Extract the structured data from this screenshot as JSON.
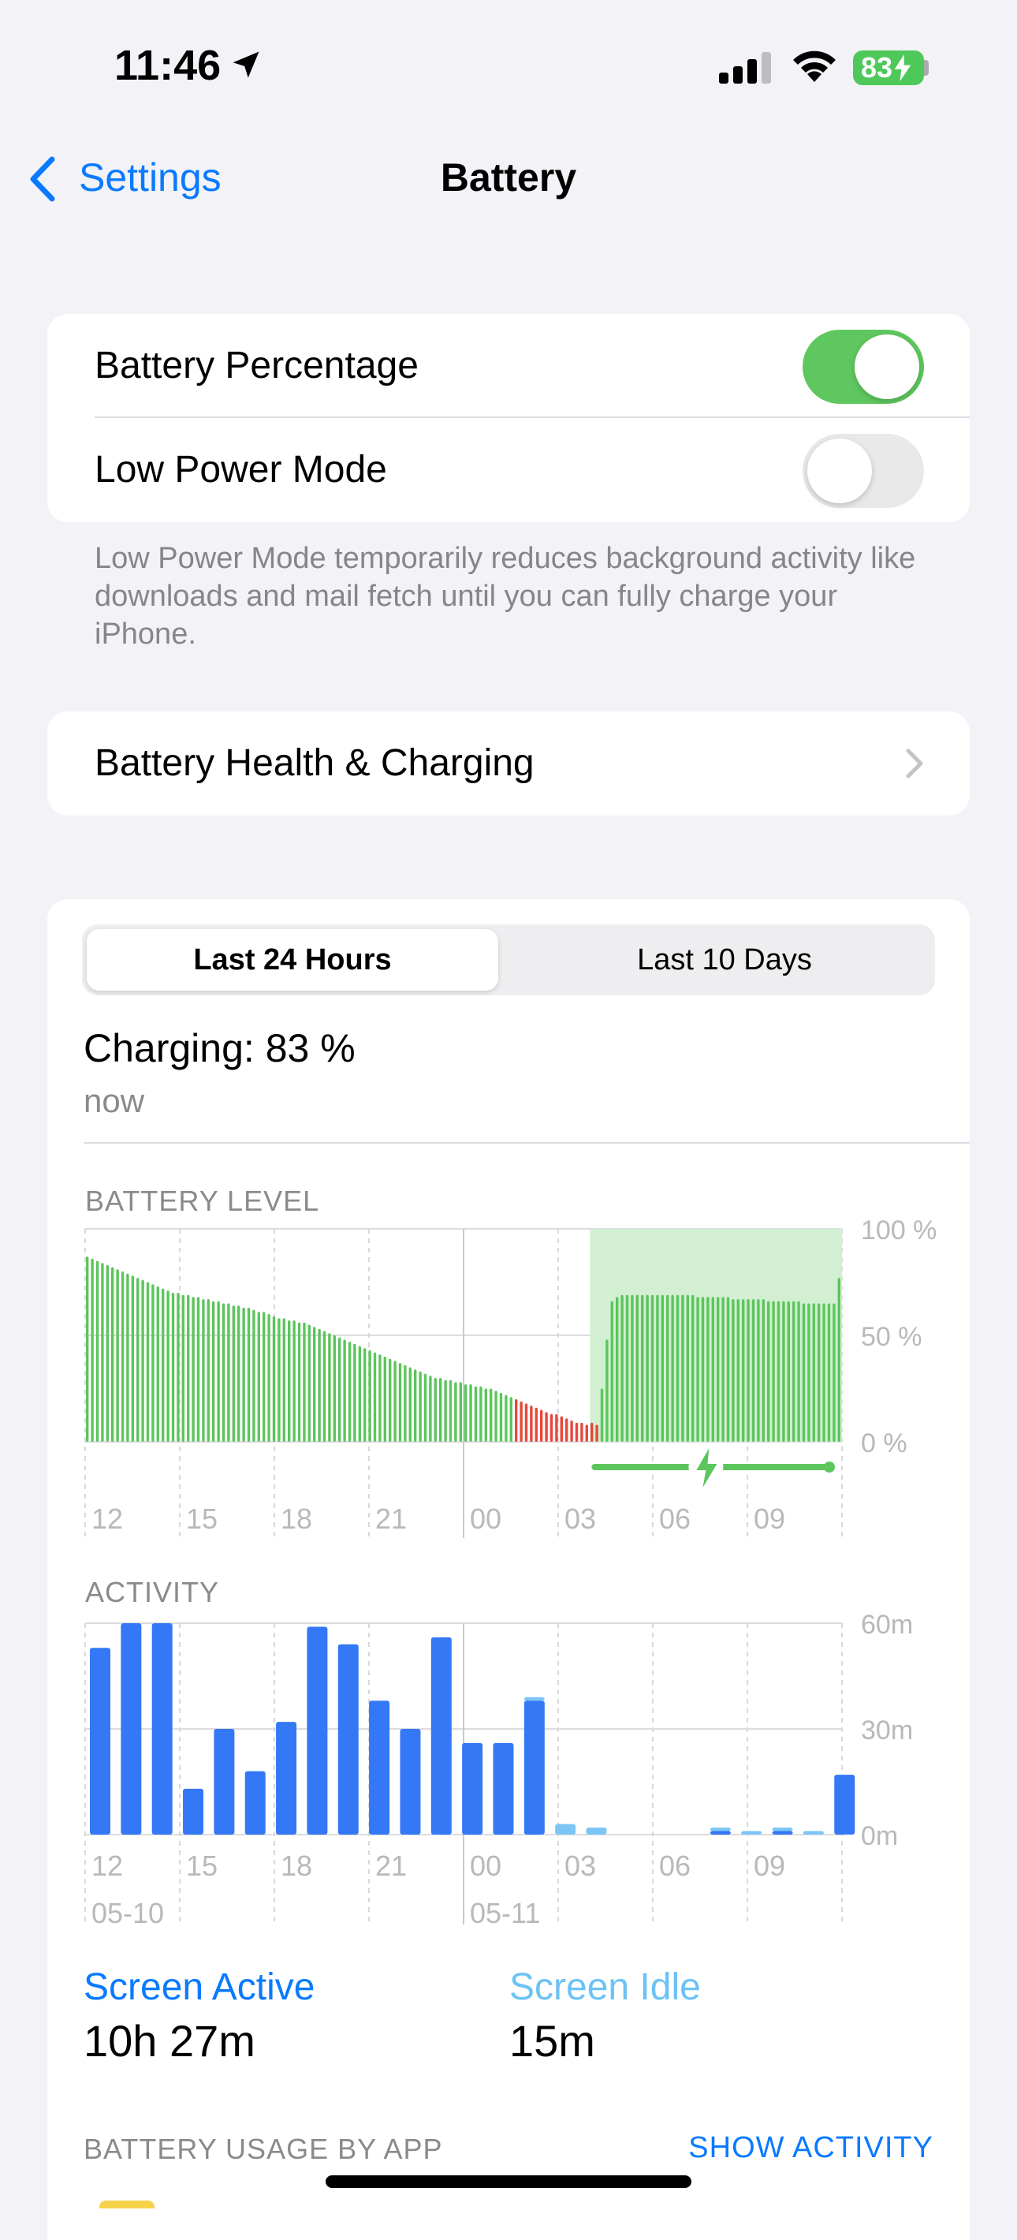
{
  "status_bar": {
    "time": "11:46",
    "battery_level": "83"
  },
  "nav": {
    "back_label": "Settings",
    "title": "Battery"
  },
  "toggles": {
    "battery_percentage": {
      "label": "Battery Percentage",
      "on": true
    },
    "low_power_mode": {
      "label": "Low Power Mode",
      "on": false
    }
  },
  "low_power_footnote": "Low Power Mode temporarily reduces background activity like downloads and mail fetch until you can fully charge your iPhone.",
  "health_row": {
    "label": "Battery Health & Charging"
  },
  "usage": {
    "tabs": [
      {
        "label": "Last 24 Hours",
        "active": true
      },
      {
        "label": "Last 10 Days",
        "active": false
      }
    ],
    "charging_title": "Charging: 83 %",
    "charging_sub": "now",
    "battery_section_label": "BATTERY LEVEL",
    "activity_section_label": "ACTIVITY",
    "legend": {
      "active_label": "Screen Active",
      "active_value": "10h 27m",
      "idle_label": "Screen Idle",
      "idle_value": "15m"
    },
    "by_app_label": "BATTERY USAGE BY APP",
    "show_activity_label": "SHOW ACTIVITY"
  },
  "colors": {
    "accent_blue": "#0a7aff",
    "battery_green": "#5cc55c",
    "battery_red": "#e8473b",
    "charging_band": "#d2efd2",
    "active_blue": "#3478f6",
    "idle_blue": "#7cc6f5"
  },
  "chart_data": [
    {
      "type": "bar",
      "title": "BATTERY LEVEL",
      "x_tick_labels": [
        "12",
        "15",
        "18",
        "21",
        "00",
        "03",
        "06",
        "09"
      ],
      "y_tick_labels": [
        "100 %",
        "50 %",
        "0 %"
      ],
      "ylim": [
        0,
        100
      ],
      "unit": "%",
      "series": [
        {
          "values": [
            87,
            86,
            85,
            84,
            83,
            82,
            81,
            80,
            79,
            78,
            77,
            76,
            75,
            74,
            73,
            72,
            71,
            70,
            70,
            69,
            69,
            68,
            68,
            67,
            67,
            66,
            66,
            65,
            65,
            64,
            64,
            63,
            63,
            62,
            61,
            61,
            60,
            59,
            58,
            58,
            57,
            57,
            56,
            56,
            55,
            54,
            53,
            52,
            51,
            50,
            49,
            48,
            47,
            46,
            45,
            44,
            43,
            42,
            41,
            40,
            39,
            38,
            37,
            36,
            35,
            34,
            33,
            32,
            31,
            30,
            30,
            29,
            29,
            28,
            28,
            27,
            27,
            26,
            26,
            25,
            25,
            24,
            23,
            22,
            21,
            20,
            19,
            18,
            17,
            16,
            15,
            14,
            13,
            13,
            12,
            11,
            10,
            9,
            9,
            8,
            9,
            8,
            25,
            48,
            66,
            68,
            69,
            69,
            69,
            69,
            69,
            69,
            69,
            69,
            69,
            69,
            69,
            69,
            69,
            69,
            69,
            68,
            68,
            68,
            68,
            68,
            68,
            68,
            67,
            67,
            67,
            67,
            67,
            67,
            67,
            66,
            66,
            66,
            66,
            66,
            66,
            66,
            65,
            65,
            65,
            65,
            65,
            65,
            65,
            77
          ],
          "low_battery_threshold": 20
        }
      ],
      "charging_range_start_index": 101,
      "grid": true
    },
    {
      "type": "bar",
      "title": "ACTIVITY",
      "x_tick_labels": [
        "12",
        "15",
        "18",
        "21",
        "00",
        "03",
        "06",
        "09"
      ],
      "date_labels": [
        "05-10",
        "05-11"
      ],
      "y_tick_labels": [
        "60m",
        "30m",
        "0m"
      ],
      "ylim": [
        0,
        60
      ],
      "unit": "minutes",
      "series": [
        {
          "name": "Screen Active",
          "values": [
            53,
            60,
            60,
            13,
            30,
            18,
            32,
            59,
            54,
            38,
            30,
            56,
            26,
            26,
            38,
            0,
            0,
            0,
            0,
            0,
            1,
            0,
            1,
            0,
            17
          ]
        },
        {
          "name": "Screen Idle",
          "values": [
            0,
            0,
            0,
            0,
            0,
            0,
            0,
            0,
            0,
            0,
            0,
            0,
            0,
            0,
            1,
            3,
            2,
            0,
            0,
            0,
            1,
            1,
            1,
            1,
            0
          ]
        }
      ],
      "grid": true
    }
  ]
}
